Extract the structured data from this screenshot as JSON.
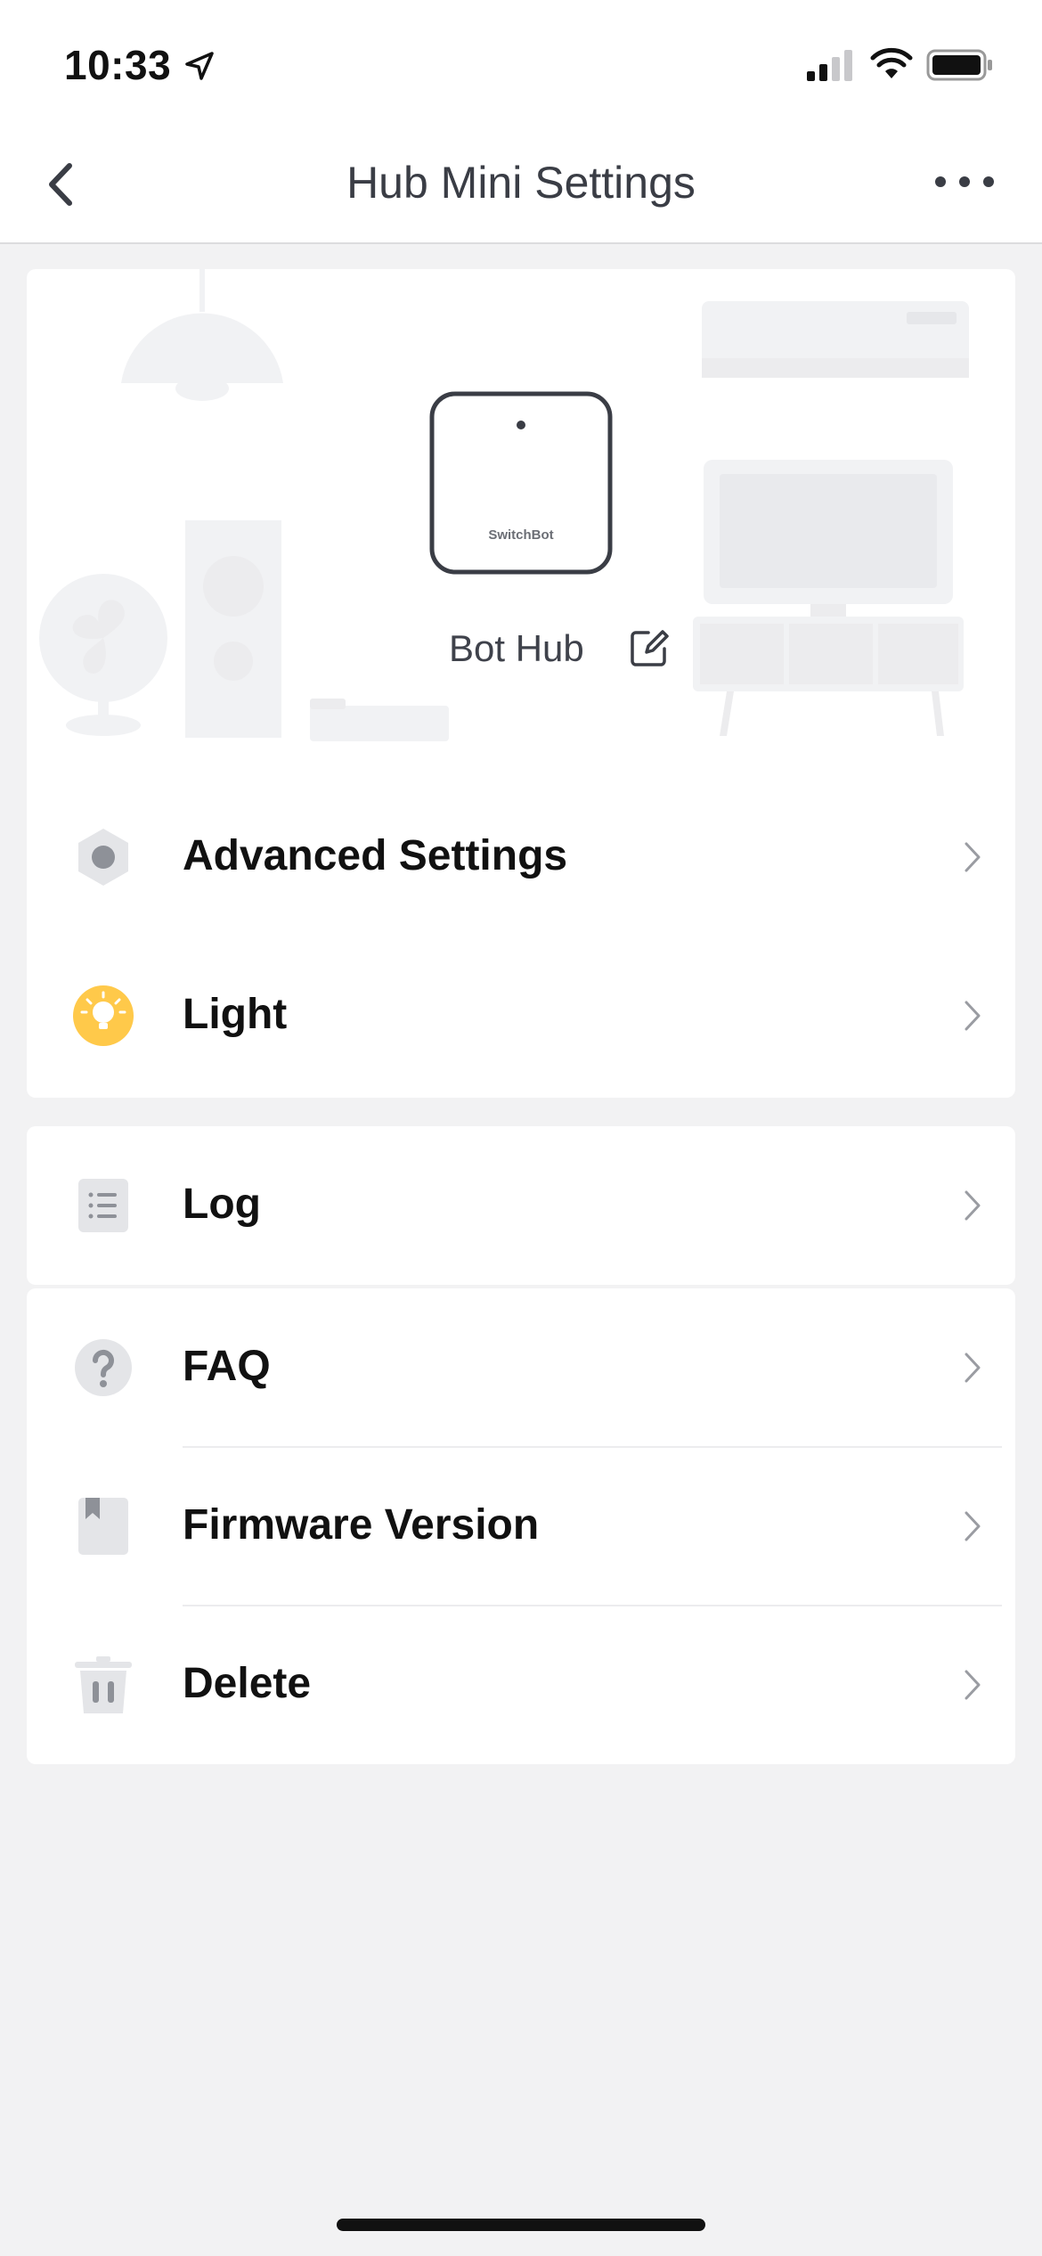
{
  "status_bar": {
    "time": "10:33"
  },
  "nav": {
    "title": "Hub Mini Settings"
  },
  "device": {
    "name": "Bot Hub",
    "brand_label": "SwitchBot"
  },
  "menu_top": [
    {
      "label": "Advanced Settings",
      "icon": "gear-icon"
    },
    {
      "label": "Light",
      "icon": "lightbulb-icon"
    }
  ],
  "menu_mid": [
    {
      "label": "Log",
      "icon": "log-list-icon"
    }
  ],
  "menu_bottom": [
    {
      "label": "FAQ",
      "icon": "question-icon"
    },
    {
      "label": "Firmware Version",
      "icon": "bookmark-icon"
    },
    {
      "label": "Delete",
      "icon": "trash-icon"
    }
  ],
  "colors": {
    "background": "#f2f2f3",
    "card": "#ffffff",
    "light_accent": "#ffc94a",
    "icon_gray": "#8e9198"
  }
}
